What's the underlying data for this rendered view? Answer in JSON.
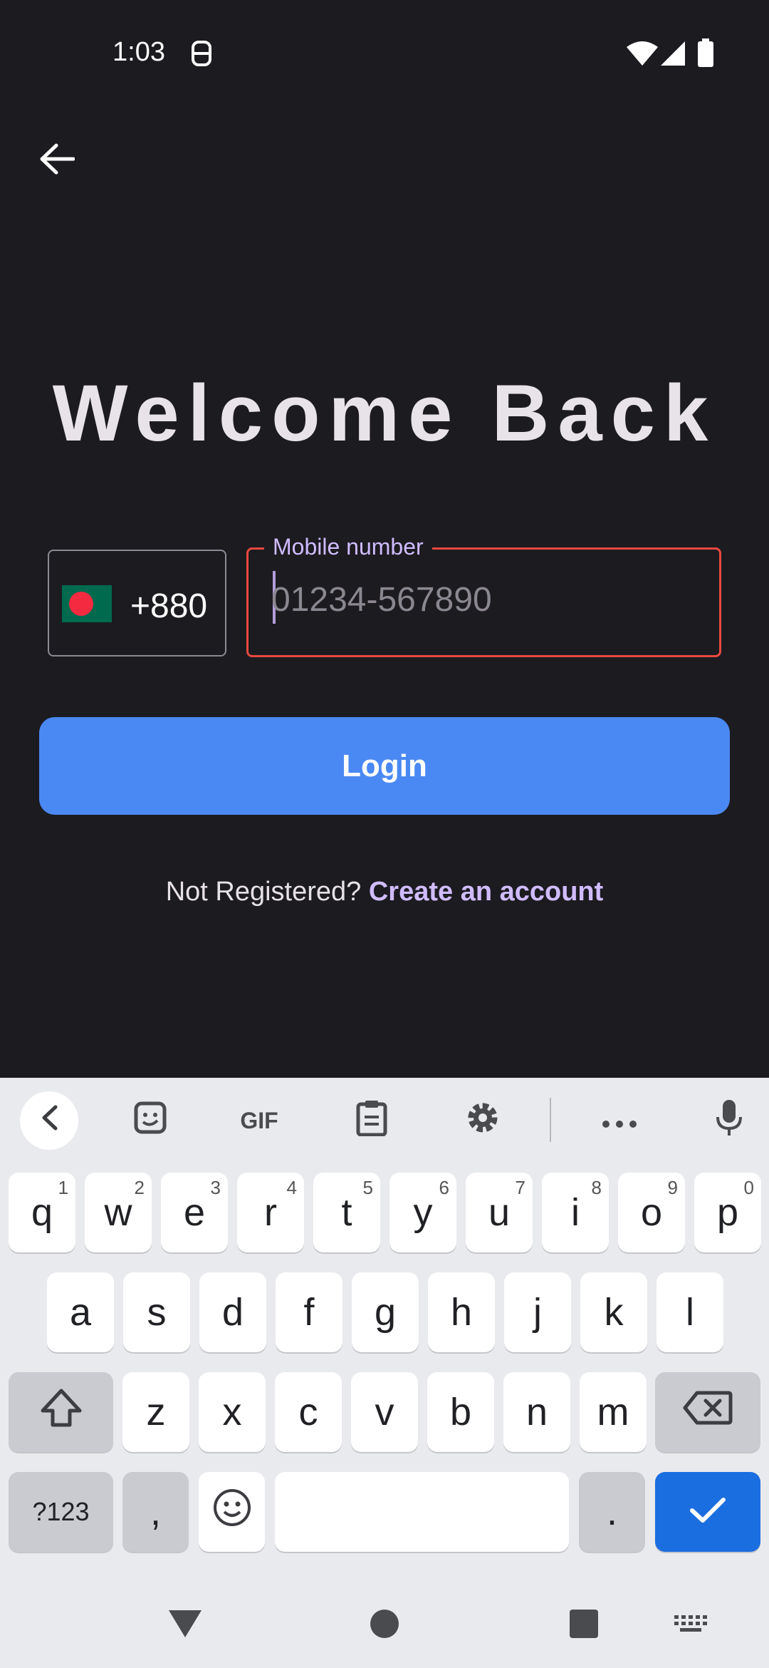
{
  "status_bar": {
    "time": "1:03",
    "icons": [
      "face-sync-icon",
      "wifi-icon",
      "signal-icon",
      "battery-icon"
    ]
  },
  "header": {
    "back_icon": "arrow-back-icon"
  },
  "main": {
    "title": "Welcome Back",
    "country": {
      "flag": "bangladesh-flag-icon",
      "code": "+880"
    },
    "phone": {
      "label": "Mobile number",
      "placeholder": "01234-567890",
      "value": ""
    },
    "login_label": "Login",
    "register_prompt": "Not Registered?",
    "register_link": "Create an account"
  },
  "keyboard": {
    "toolbar": {
      "items": [
        "chevron-left-icon",
        "sticker-icon",
        "GIF",
        "clipboard-icon",
        "gear-icon",
        "more-icon",
        "mic-icon"
      ],
      "gif_label": "GIF"
    },
    "row1": [
      {
        "k": "q",
        "h": "1"
      },
      {
        "k": "w",
        "h": "2"
      },
      {
        "k": "e",
        "h": "3"
      },
      {
        "k": "r",
        "h": "4"
      },
      {
        "k": "t",
        "h": "5"
      },
      {
        "k": "y",
        "h": "6"
      },
      {
        "k": "u",
        "h": "7"
      },
      {
        "k": "i",
        "h": "8"
      },
      {
        "k": "o",
        "h": "9"
      },
      {
        "k": "p",
        "h": "0"
      }
    ],
    "row2": [
      "a",
      "s",
      "d",
      "f",
      "g",
      "h",
      "j",
      "k",
      "l"
    ],
    "row3": [
      "z",
      "x",
      "c",
      "v",
      "b",
      "n",
      "m"
    ],
    "symbols_label": "?123",
    "comma_label": ",",
    "period_label": ".",
    "colors": {
      "enter": "#1b6ee0",
      "login": "#4a89f3",
      "link": "#d0bcff",
      "error_border": "#e8483e"
    }
  },
  "nav": {
    "icons": [
      "back-triangle-icon",
      "home-circle-icon",
      "recents-square-icon",
      "keyboard-switch-icon"
    ]
  }
}
